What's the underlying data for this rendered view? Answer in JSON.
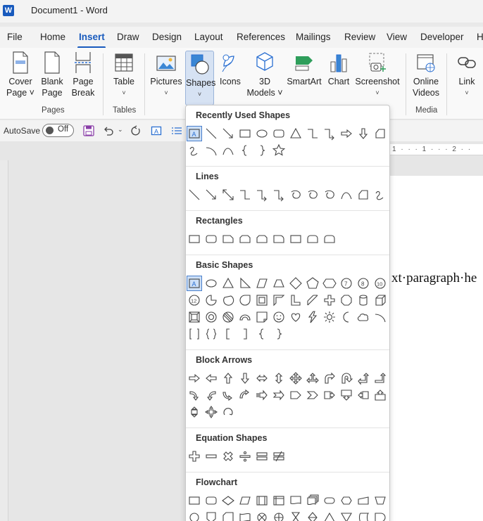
{
  "window": {
    "title": "Document1  -  Word",
    "app_icon": "W"
  },
  "tabs": [
    "File",
    "Home",
    "Insert",
    "Draw",
    "Design",
    "Layout",
    "References",
    "Mailings",
    "Review",
    "View",
    "Developer",
    "H"
  ],
  "active_tab": "Insert",
  "ribbon": {
    "buttons": [
      {
        "name": "cover-page",
        "label1": "Cover",
        "label2": "Page ˅",
        "icon": "cover-page-icon"
      },
      {
        "name": "blank-page",
        "label1": "Blank",
        "label2": "Page",
        "icon": "blank-page-icon"
      },
      {
        "name": "page-break",
        "label1": "Page",
        "label2": "Break",
        "icon": "page-break-icon"
      },
      {
        "name": "table",
        "label1": "Table",
        "label2": "˅",
        "icon": "table-icon"
      },
      {
        "name": "pictures",
        "label1": "Pictures",
        "label2": "˅",
        "icon": "pictures-icon"
      },
      {
        "name": "shapes",
        "label1": "Shapes",
        "label2": "˅",
        "icon": "shapes-icon"
      },
      {
        "name": "icons",
        "label1": "Icons",
        "label2": "",
        "icon": "icons-icon"
      },
      {
        "name": "3d-models",
        "label1": "3D",
        "label2": "Models ˅",
        "icon": "3d-models-icon"
      },
      {
        "name": "smartart",
        "label1": "SmartArt",
        "label2": "",
        "icon": "smartart-icon"
      },
      {
        "name": "chart",
        "label1": "Chart",
        "label2": "",
        "icon": "chart-icon"
      },
      {
        "name": "screenshot",
        "label1": "Screenshot",
        "label2": "˅",
        "icon": "screenshot-icon"
      },
      {
        "name": "online-videos",
        "label1": "Online",
        "label2": "Videos",
        "icon": "online-videos-icon"
      },
      {
        "name": "link",
        "label1": "Link",
        "label2": "˅",
        "icon": "link-icon"
      }
    ],
    "groups": {
      "pages": "Pages",
      "tables": "Tables",
      "media": "Media"
    }
  },
  "quick_access": {
    "autosave_label": "AutoSave",
    "autosave_state": "Off"
  },
  "document": {
    "visible_text": "xt·paragraph·he",
    "ruler_marks": "1 · · · 1 · · · 2 · ·"
  },
  "shapes_panel": {
    "sections": [
      {
        "title": "Recently Used Shapes",
        "count": 23
      },
      {
        "title": "Lines",
        "count": 12
      },
      {
        "title": "Rectangles",
        "count": 9
      },
      {
        "title": "Basic Shapes",
        "count": 42
      },
      {
        "title": "Block Arrows",
        "count": 27
      },
      {
        "title": "Equation Shapes",
        "count": 6
      },
      {
        "title": "Flowchart",
        "count": 24
      }
    ]
  },
  "colors": {
    "accent": "#185abd",
    "selected_bg": "#d6e2f3"
  }
}
